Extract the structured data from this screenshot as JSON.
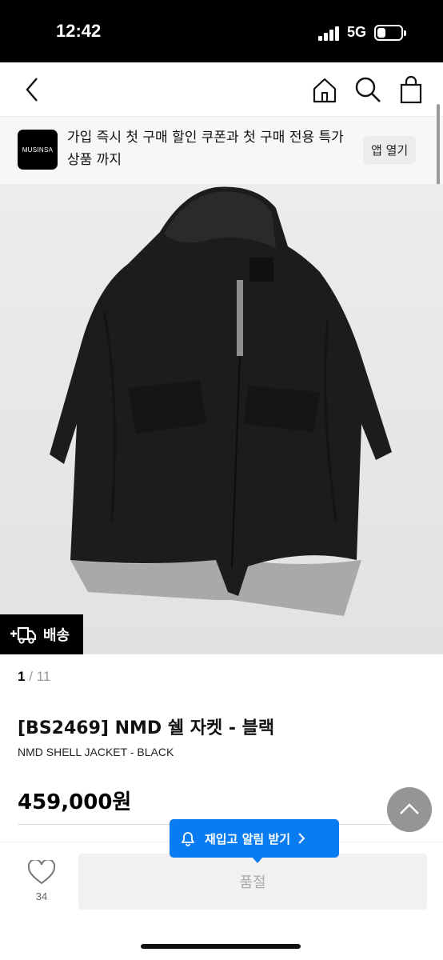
{
  "status_bar": {
    "time": "12:42",
    "network": "5G"
  },
  "header": {
    "icons": [
      "back-icon",
      "home-icon",
      "search-icon",
      "shopping-bag-icon"
    ]
  },
  "app_banner": {
    "logo_text": "MUSINSA",
    "message": "가입 즉시 첫 구매 할인 쿠폰과 첫 구매 전용 특가 상품 까지",
    "open_app_label": "앱 열기"
  },
  "product": {
    "delivery_badge": "배송",
    "image_index": "1",
    "image_separator": "/",
    "image_total": "11",
    "title": "[BS2469] NMD 쉘 자켓 - 블랙",
    "subtitle": "NMD SHELL JACKET - BLACK",
    "price": "459,000원"
  },
  "restock_alert": {
    "label": "재입고 알림 받기"
  },
  "bottom_bar": {
    "like_count": "34",
    "soldout_label": "품절"
  },
  "colors": {
    "accent": "#0a7cf2",
    "soldout_bg": "#f1f1f1"
  }
}
